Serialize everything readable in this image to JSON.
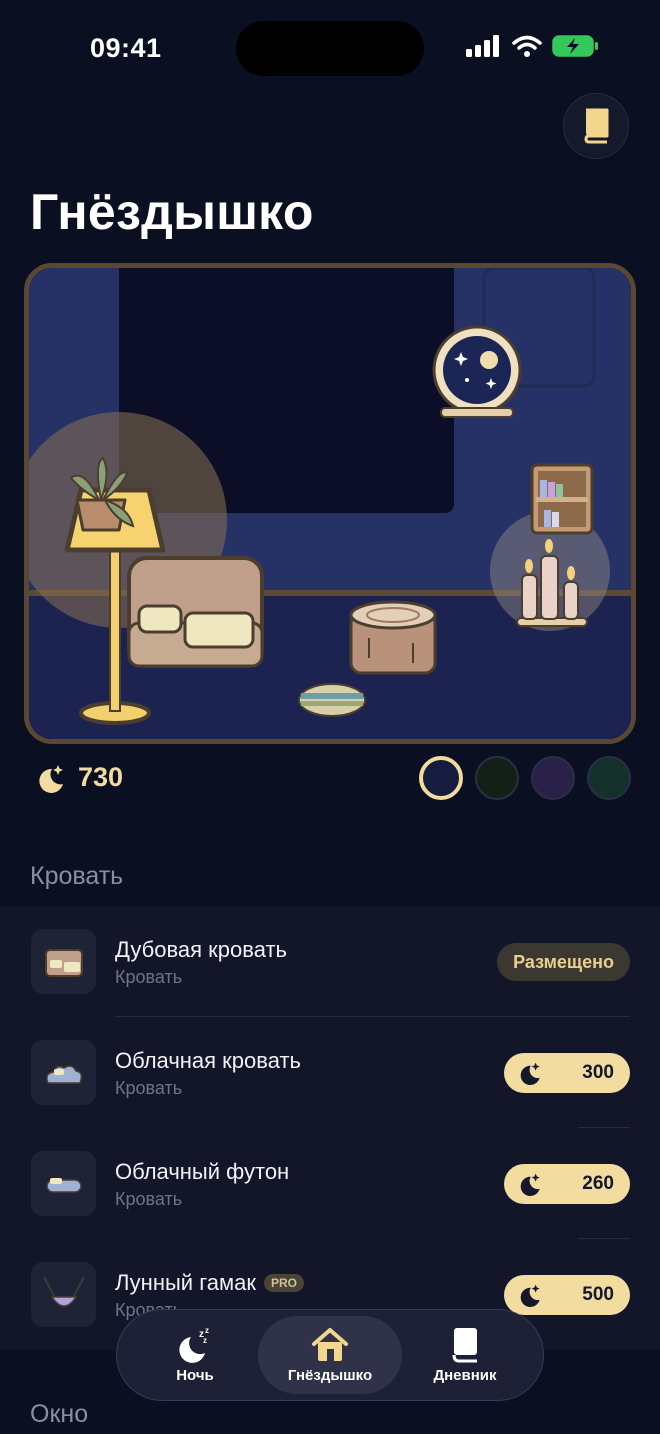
{
  "status": {
    "time": "09:41"
  },
  "header": {
    "title": "Гнёздышко"
  },
  "balance": {
    "value": "730"
  },
  "colors": {
    "accent": "#f2dca0",
    "background": "#0b0f22",
    "swatches": [
      "#161c3f",
      "#122018",
      "#2a2149",
      "#14302b"
    ]
  },
  "sections": [
    {
      "title": "Кровать",
      "items": [
        {
          "name": "Дубовая кровать",
          "category": "Кровать",
          "status": "Размещено",
          "placed": true
        },
        {
          "name": "Облачная кровать",
          "category": "Кровать",
          "price": "300"
        },
        {
          "name": "Облачный футон",
          "category": "Кровать",
          "price": "260"
        },
        {
          "name": "Лунный гамак",
          "category": "Кровать",
          "price": "500",
          "badge": "PRO"
        }
      ]
    },
    {
      "title": "Окно"
    }
  ],
  "tabs": [
    {
      "label": "Ночь",
      "icon": "moon-sleep-icon"
    },
    {
      "label": "Гнёздышко",
      "icon": "house-icon",
      "active": true
    },
    {
      "label": "Дневник",
      "icon": "book-icon"
    }
  ]
}
